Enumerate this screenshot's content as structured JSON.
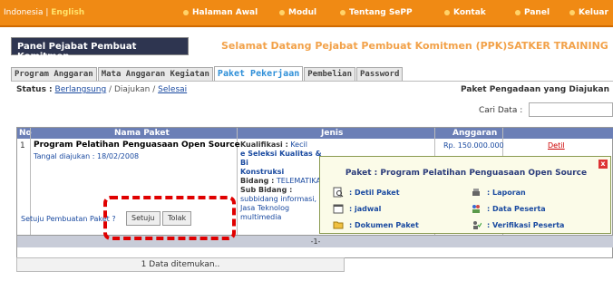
{
  "topbar": {
    "lang_prefix": "Indonesia | ",
    "lang_active": "English",
    "nav": [
      "Halaman Awal",
      "Modul",
      "Tentang SePP",
      "Kontak",
      "Panel",
      "Keluar"
    ]
  },
  "header": {
    "panel_title": "Panel Pejabat Pembuat Komitmen",
    "welcome": "Selamat Datang Pejabat Pembuat Komitmen (PPK)SATKER TRAINING"
  },
  "tabs": [
    {
      "label": "Program Anggaran",
      "active": false
    },
    {
      "label": "Mata Anggaran Kegiatan",
      "active": false
    },
    {
      "label": "Paket Pekerjaan",
      "active": true
    },
    {
      "label": "Pembelian",
      "active": false
    },
    {
      "label": "Password",
      "active": false
    }
  ],
  "status": {
    "label": "Status :",
    "berlangsung": "Berlangsung",
    "sep1": " / ",
    "diajukan": "Diajukan",
    "sep2": " / ",
    "selesai": "Selesai"
  },
  "right_title": "Paket Pengadaan yang Diajukan",
  "search": {
    "label": "Cari Data :",
    "value": ""
  },
  "table": {
    "headers": [
      "No",
      "Nama Paket",
      "Jenis",
      "Anggaran"
    ],
    "row": {
      "no": "1",
      "nama": "Program Pelatihan Penguasaan Open Source",
      "tanggal": "Tangal diajukan : 18/02/2008",
      "kualifikasi_label": "Kualifikasi :",
      "kualifikasi": "Kecil",
      "seleksi": "e Seleksi Kualitas & Bi",
      "konstruksi": "Konstruksi",
      "bidang_label": "Bidang :",
      "bidang": "TELEMATIKA",
      "subbidang_label": "Sub Bidang :",
      "subbidang": "subbidang informasi, Jasa Teknolog multimedia",
      "anggaran": "Rp. 150.000.000",
      "detil": "Detil",
      "setuju_question": "Setuju Pembuatan Paket ?",
      "setuju_btn": "Setuju",
      "tolak_btn": "Tolak"
    },
    "pager": "-1-"
  },
  "found": "1 Data ditemukan..",
  "popup": {
    "close": "x",
    "title": "Paket : Program Pelatihan Penguasaan Open Source",
    "items": [
      ": Detil Paket",
      ": Laporan",
      ": jadwal",
      ": Data Peserta",
      ": Dokumen Paket",
      ": Verifikasi Peserta"
    ]
  },
  "colors": {
    "topbar": "#f08a14",
    "highlight": "#e00000",
    "table_header": "#6b7fb6",
    "link": "#1a4aa0"
  }
}
